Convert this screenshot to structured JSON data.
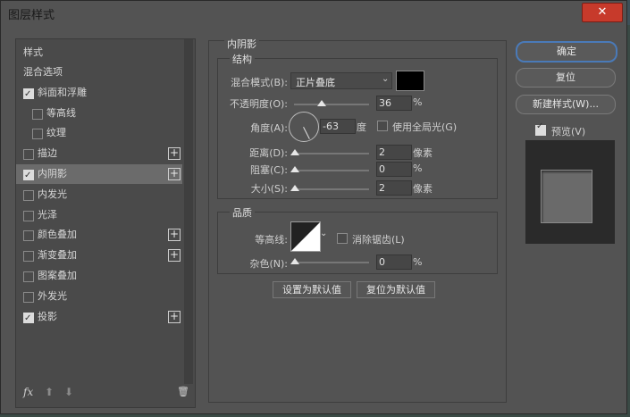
{
  "window": {
    "title": "图层样式",
    "close_glyph": "✕"
  },
  "left": {
    "header": "样式",
    "items": [
      {
        "label": "混合选项",
        "checkbox": false,
        "checked": false,
        "plus": false,
        "indent": 0,
        "selected": false
      },
      {
        "label": "斜面和浮雕",
        "checkbox": true,
        "checked": true,
        "plus": false,
        "indent": 0,
        "selected": false
      },
      {
        "label": "等高线",
        "checkbox": true,
        "checked": false,
        "plus": false,
        "indent": 1,
        "selected": false
      },
      {
        "label": "纹理",
        "checkbox": true,
        "checked": false,
        "plus": false,
        "indent": 1,
        "selected": false
      },
      {
        "label": "描边",
        "checkbox": true,
        "checked": false,
        "plus": true,
        "indent": 0,
        "selected": false
      },
      {
        "label": "内阴影",
        "checkbox": true,
        "checked": true,
        "plus": true,
        "indent": 0,
        "selected": true
      },
      {
        "label": "内发光",
        "checkbox": true,
        "checked": false,
        "plus": false,
        "indent": 0,
        "selected": false
      },
      {
        "label": "光泽",
        "checkbox": true,
        "checked": false,
        "plus": false,
        "indent": 0,
        "selected": false
      },
      {
        "label": "颜色叠加",
        "checkbox": true,
        "checked": false,
        "plus": true,
        "indent": 0,
        "selected": false
      },
      {
        "label": "渐变叠加",
        "checkbox": true,
        "checked": false,
        "plus": true,
        "indent": 0,
        "selected": false
      },
      {
        "label": "图案叠加",
        "checkbox": true,
        "checked": false,
        "plus": false,
        "indent": 0,
        "selected": false
      },
      {
        "label": "外发光",
        "checkbox": true,
        "checked": false,
        "plus": false,
        "indent": 0,
        "selected": false
      },
      {
        "label": "投影",
        "checkbox": true,
        "checked": true,
        "plus": true,
        "indent": 0,
        "selected": false
      }
    ],
    "plus_glyph": "+",
    "bottom": {
      "fx": "fx",
      "up": "⬆",
      "down": "⬇",
      "trash": "🗑"
    }
  },
  "main": {
    "group_title": "内阴影",
    "structure": {
      "title": "结构",
      "blend_mode_label": "混合模式(B):",
      "blend_mode_value": "正片叠底",
      "opacity_label": "不透明度(O):",
      "opacity_value": "36",
      "opacity_unit": "%",
      "opacity_level": 0.36,
      "angle_label": "角度(A):",
      "angle_value": "-63",
      "angle_unit": "度",
      "global_light_label": "使用全局光(G)",
      "distance_label": "距离(D):",
      "distance_value": "2",
      "distance_unit": "像素",
      "choke_label": "阻塞(C):",
      "choke_value": "0",
      "choke_unit": "%",
      "size_label": "大小(S):",
      "size_value": "2",
      "size_unit": "像素"
    },
    "quality": {
      "title": "品质",
      "contour_label": "等高线:",
      "antialias_label": "消除锯齿(L)",
      "noise_label": "杂色(N):",
      "noise_value": "0",
      "noise_unit": "%"
    },
    "set_default": "设置为默认值",
    "reset_default": "复位为默认值"
  },
  "right": {
    "ok": "确定",
    "reset": "复位",
    "new_style": "新建样式(W)...",
    "preview_label": "预览(V)"
  },
  "colors": {
    "shadow_color": "#000000",
    "accent_border": "#4a7ab8"
  }
}
